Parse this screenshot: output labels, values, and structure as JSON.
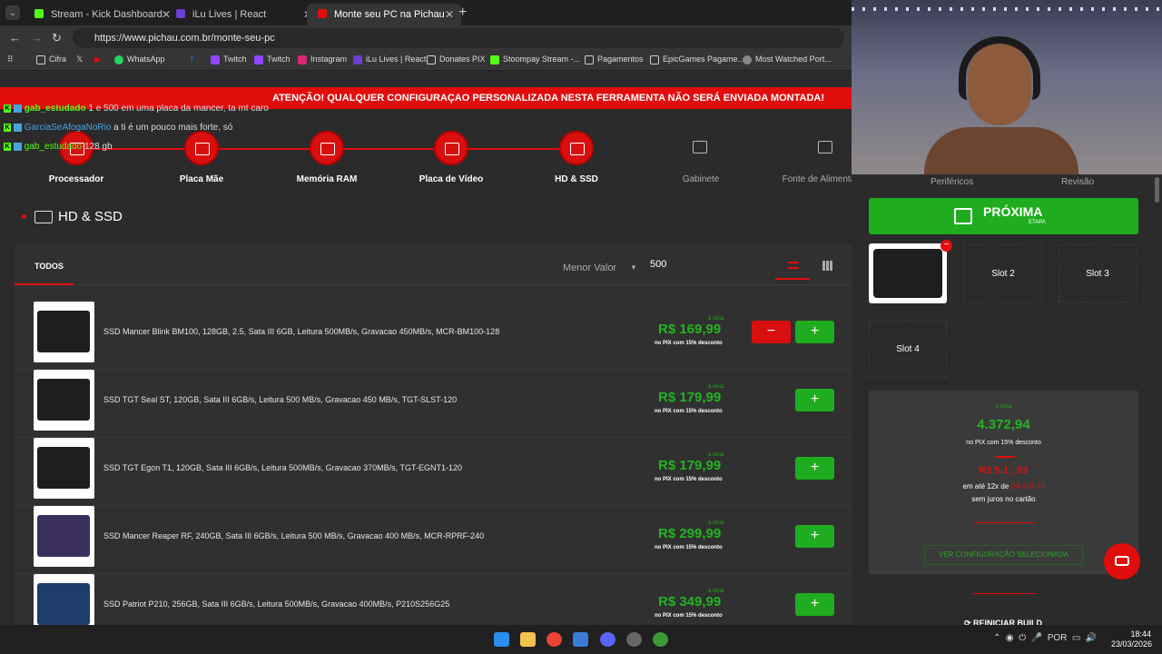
{
  "browser": {
    "tabs": [
      {
        "label": "Stream - Kick Dashboard",
        "color": "#53fc18"
      },
      {
        "label": "iLu Lives | React",
        "color": "#6a3fd1"
      },
      {
        "label": "Monte seu PC na Pichau",
        "color": "#e10d0d"
      }
    ],
    "url": "https://www.pichau.com.br/monte-seu-pc",
    "bookmarks": [
      "Cifra",
      "WhatsApp",
      "Twitch",
      "Twitch",
      "Instagram",
      "iLu Lives | React",
      "Donates PIX",
      "Stoompay Stream -...",
      "Pagamentos",
      "EpicGames Pagame...",
      "Most Watched Port..."
    ]
  },
  "alert": "ATENÇÃO! QUALQUER CONFIGURAÇAO PERSONALIZADA NESTA FERRAMENTA NÃO SERÁ ENVIADA MONTADA!",
  "chat": [
    {
      "user": "gab_estudado",
      "text": "1 e 500 em uma placa da mancer, ta mt caro",
      "color": "#53fc18"
    },
    {
      "user": "GarciaSeAfogaNoRio",
      "text": "a ti é um pouco mais forte, só",
      "color": "#4aa3df"
    },
    {
      "user": "gab_estudado",
      "text": "128 gb",
      "color": "#53fc18"
    }
  ],
  "steps": [
    "Processador",
    "Placa Mãe",
    "Memória RAM",
    "Placa de Vídeo",
    "HD & SSD",
    "Gabinete",
    "Fonte de Alimentação",
    "Periféricos",
    "Revisão"
  ],
  "section_title": "HD & SSD",
  "filters": {
    "tab": "TODOS",
    "sort": "Menor Valor",
    "max_price": "500"
  },
  "products": [
    {
      "name": "SSD Mancer Blink BM100, 128GB, 2.5, Sata III 6GB, Leitura 500MB/s, Gravacao 450MB/s, MCR-BM100-128",
      "price": "R$ 169,99",
      "avista": "à vista",
      "pix": "no PIX com 15% desconto",
      "selected": true
    },
    {
      "name": "SSD TGT Seal ST, 120GB, Sata III 6GB/s, Leitura 500 MB/s, Gravacao 450 MB/s, TGT-SLST-120",
      "price": "R$ 179,99",
      "avista": "à vista",
      "pix": "no PIX com 15% desconto",
      "selected": false
    },
    {
      "name": "SSD TGT Egon T1, 120GB, Sata III 6GB/s, Leitura 500MB/s, Gravacao 370MB/s, TGT-EGNT1-120",
      "price": "R$ 179,99",
      "avista": "à vista",
      "pix": "no PIX com 15% desconto",
      "selected": false
    },
    {
      "name": "SSD Mancer Reaper RF, 240GB, Sata III 6GB/s, Leitura 500 MB/s, Gravacao 400 MB/s, MCR-RPRF-240",
      "price": "R$ 299,99",
      "avista": "à vista",
      "pix": "no PIX com 15% desconto",
      "selected": false
    },
    {
      "name": "SSD Patriot P210, 256GB, Sata III 6GB/s, Leitura 500MB/s, Gravacao 400MB/s, P210S256G25",
      "price": "R$ 349,99",
      "avista": "à vista",
      "pix": "no PIX com 15% desconto",
      "selected": false
    }
  ],
  "next": {
    "label": "PRÓXIMA",
    "sub": "ETAPA"
  },
  "slots": [
    "Slot 2",
    "Slot 3",
    "Slot 4"
  ],
  "summary": {
    "avista": "à vista",
    "price": "4.372,94",
    "pix": "no PIX com 15% desconto",
    "full": "R$ 5.1_,53",
    "installments_prefix": "em até 12x de",
    "installments_value": "R$ 428,73",
    "no_interest": "sem juros no cartão",
    "view_config": "VER CONFIGURAÇÃO SELECIONADA"
  },
  "reset": "REINICIAR BUILD",
  "taskbar": {
    "lang": "POR",
    "time": "18:44",
    "date": "23/03/2026"
  },
  "accent": "#e10d0d",
  "green": "#1fad1f"
}
